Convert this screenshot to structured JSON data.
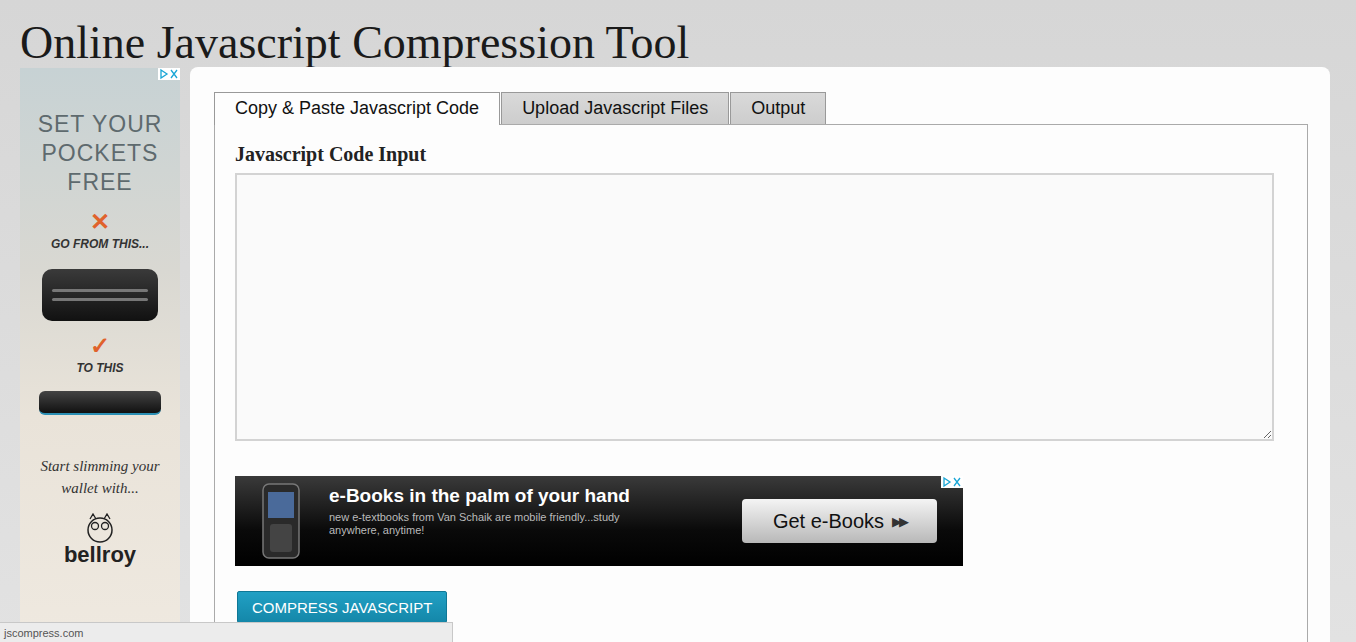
{
  "page": {
    "title": "Online Javascript Compression Tool"
  },
  "tabs": [
    {
      "label": "Copy & Paste Javascript Code",
      "selected": true
    },
    {
      "label": "Upload Javascript Files",
      "selected": false
    },
    {
      "label": "Output",
      "selected": false
    }
  ],
  "input": {
    "label": "Javascript Code Input"
  },
  "side_ad": {
    "headline": "SET YOUR POCKETS FREE",
    "from_mark": "✕",
    "from_caption": "GO FROM THIS...",
    "to_mark": "✓",
    "to_caption": "TO THIS",
    "tagline": "Start slimming your wallet with...",
    "brand": "bellroy"
  },
  "banner_ad": {
    "title": "e-Books in the palm of your hand",
    "text": "new e-textbooks from Van Schaik are mobile friendly...study anywhere, anytime!",
    "button": "Get e-Books",
    "button_icon": "▶▶"
  },
  "action": {
    "label": "COMPRESS JAVASCRIPT"
  },
  "status_bar": {
    "url": "jscompress.com"
  }
}
